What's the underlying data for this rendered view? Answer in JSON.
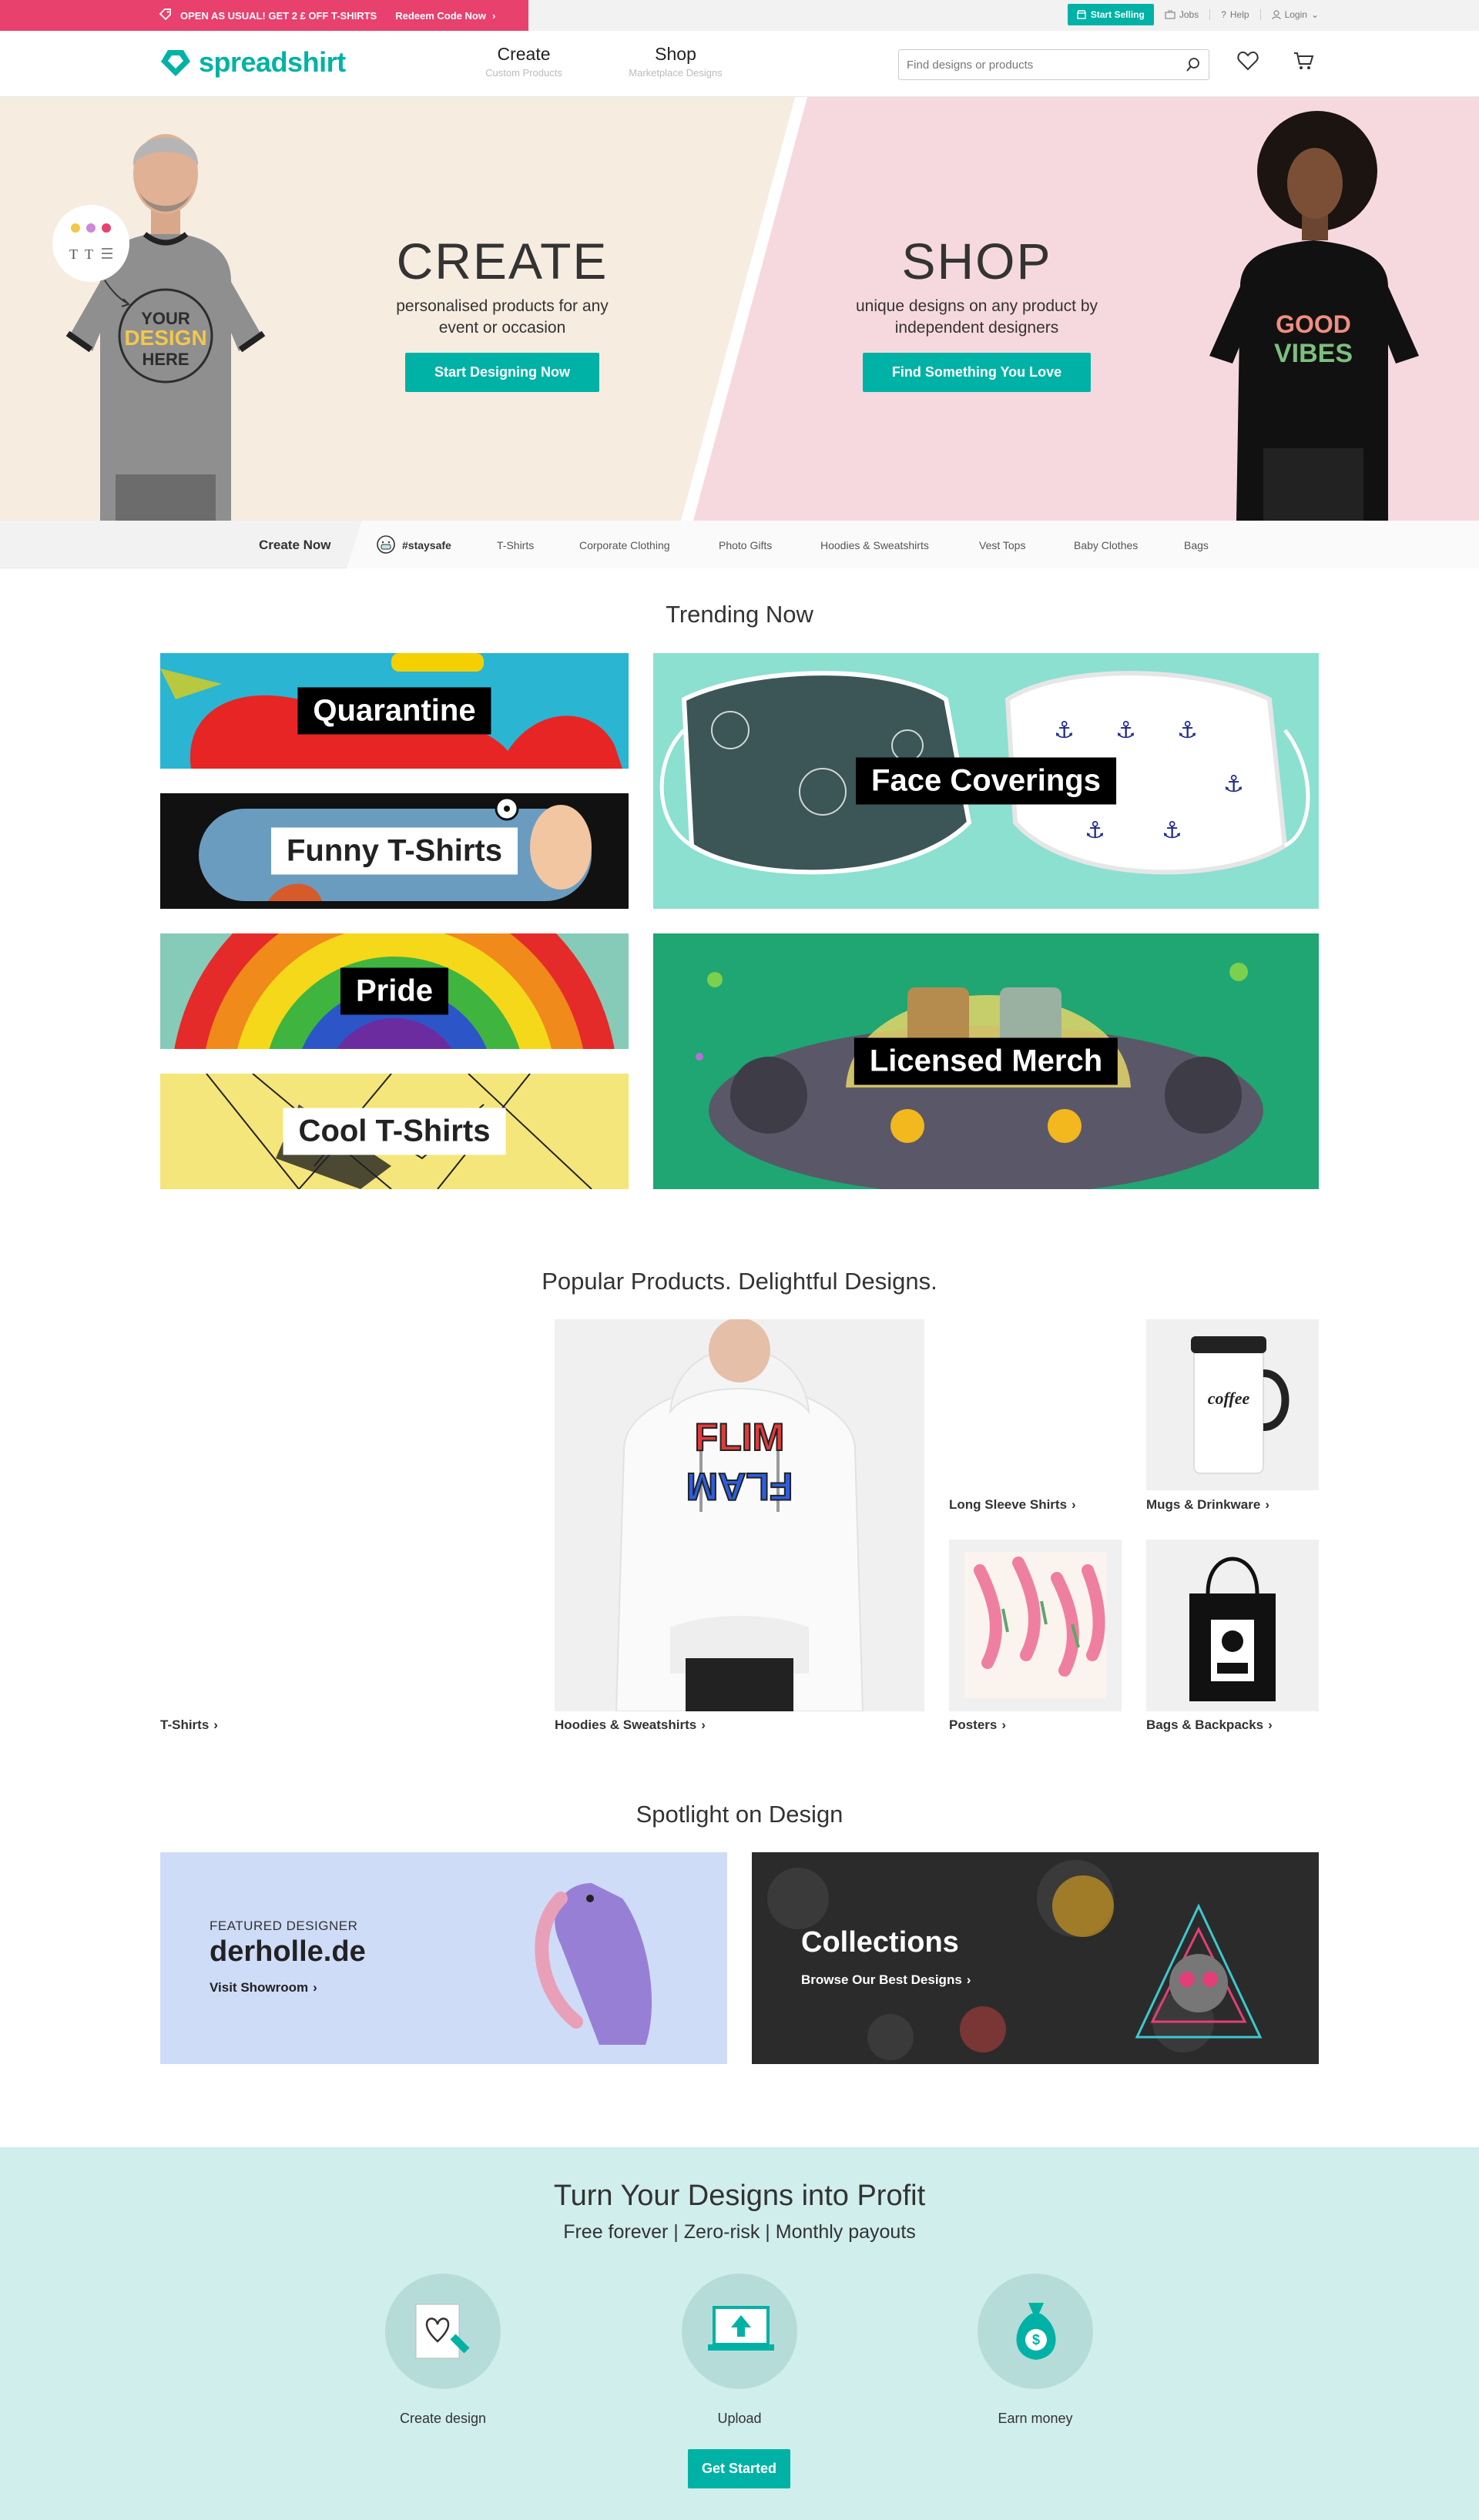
{
  "topbar": {
    "promo_text": "OPEN AS USUAL! GET 2 £ OFF T-SHIRTS",
    "redeem": "Redeem Code Now",
    "start_selling": "Start Selling",
    "jobs": "Jobs",
    "help": "Help",
    "login": "Login"
  },
  "header": {
    "logo": "spreadshirt",
    "nav": [
      {
        "title": "Create",
        "sub": "Custom Products"
      },
      {
        "title": "Shop",
        "sub": "Marketplace Designs"
      }
    ],
    "search_placeholder": "Find designs or products"
  },
  "hero": {
    "create": {
      "title": "CREATE",
      "line1": "personalised products for any",
      "line2": "event or occasion",
      "button": "Start Designing Now"
    },
    "shop": {
      "title": "SHOP",
      "line1": "unique designs on any product by",
      "line2": "independent designers",
      "button": "Find Something You Love"
    },
    "shirt_left": [
      "YOUR",
      "DESIGN",
      "HERE"
    ],
    "shirt_right": [
      "GOOD",
      "VIBES"
    ]
  },
  "catnav": {
    "create_now": "Create Now",
    "items": [
      "#staysafe",
      "T-Shirts",
      "Corporate Clothing",
      "Photo Gifts",
      "Hoodies & Sweatshirts",
      "Vest Tops",
      "Baby Clothes",
      "Bags"
    ]
  },
  "trending": {
    "title": "Trending Now",
    "tiles": [
      "Quarantine",
      "Funny T-Shirts",
      "Pride",
      "Cool T-Shirts",
      "Face Coverings",
      "Licensed Merch"
    ]
  },
  "popular": {
    "title": "Popular Products. Delightful Designs.",
    "products": [
      "T-Shirts",
      "Hoodies & Sweatshirts",
      "Long Sleeve Shirts",
      "Mugs & Drinkware",
      "Posters",
      "Bags & Backpacks"
    ],
    "hoodie_print": [
      "FLIM",
      "FLAM"
    ],
    "mug_print": "coffee"
  },
  "spotlight": {
    "title": "Spotlight on Design",
    "featured_label": "FEATURED DESIGNER",
    "featured_name": "derholle.de",
    "featured_link": "Visit Showroom",
    "collections_title": "Collections",
    "collections_link": "Browse Our Best Designs"
  },
  "profit": {
    "title": "Turn Your Designs into Profit",
    "subtitle": "Free forever | Zero-risk | Monthly payouts",
    "steps": [
      "Create design",
      "Upload",
      "Earn money"
    ],
    "button": "Get Started"
  },
  "colors": {
    "brand": "#00b2a5",
    "promo": "#e8416e",
    "hero_left": "#f6ece0",
    "hero_right": "#f6d9df",
    "profit_bg": "#d0eeec"
  }
}
